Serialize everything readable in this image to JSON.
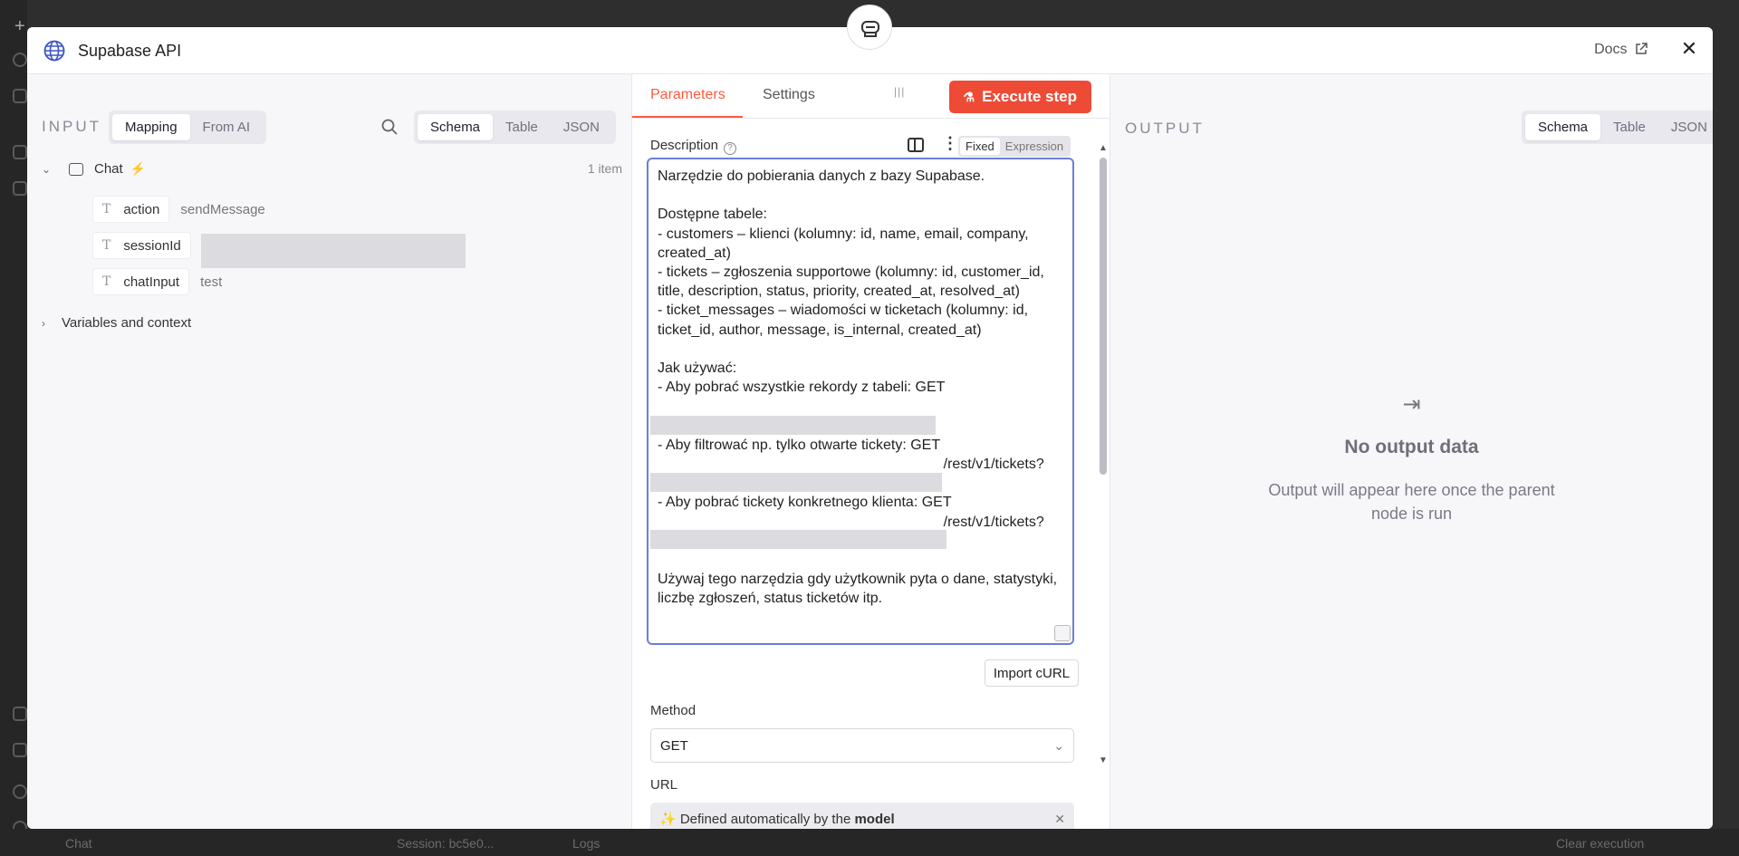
{
  "background": {
    "bottom_chat": "Chat",
    "bottom_session": "Session: bc5e0...",
    "bottom_logs": "Logs",
    "bottom_clear": "Clear execution"
  },
  "modal": {
    "title": "Supabase API",
    "docs_label": "Docs"
  },
  "input": {
    "label": "INPUT",
    "mode_tabs": [
      "Mapping",
      "From AI"
    ],
    "mode_selected": "Mapping",
    "view_tabs": [
      "Schema",
      "Table",
      "JSON"
    ],
    "view_selected": "Schema",
    "node_name": "Chat",
    "item_count": "1 item",
    "fields": [
      {
        "key": "action",
        "value": "sendMessage"
      },
      {
        "key": "sessionId",
        "value": ""
      },
      {
        "key": "chatInput",
        "value": "test"
      }
    ],
    "variables_label": "Variables and context"
  },
  "params": {
    "tabs": [
      "Parameters",
      "Settings"
    ],
    "active_tab": "Parameters",
    "execute_label": "Execute step",
    "description_label": "Description",
    "toggle": [
      "Fixed",
      "Expression"
    ],
    "toggle_selected": "Fixed",
    "description_text": "Narzędzie do pobierania danych z bazy Supabase.\n\nDostępne tabele:\n- customers – klienci (kolumny: id, name, email, company, created_at)\n- tickets – zgłoszenia supportowe (kolumny: id, customer_id, title, description, status, priority, created_at, resolved_at)\n- ticket_messages – wiadomości w ticketach (kolumny: id, ticket_id, author, message, is_internal, created_at)\n\nJak używać:\n- Aby pobrać wszystkie rekordy z tabeli: GET\n                                                                      /rest/v1/NAZWA_TABELI\n- Aby filtrować np. tylko otwarte tickety: GET\n                                                                       /rest/v1/tickets?status=eq.open\n- Aby pobrać tickety konkretnego klienta: GET\n                                                                       /rest/v1/tickets?customer_id=eq.UUID\n\nUżywaj tego narzędzia gdy użytkownik pyta o dane, statystyki, liczbę zgłoszeń, status ticketów itp.",
    "import_label": "Import cURL",
    "method_label": "Method",
    "method_value": "GET",
    "url_label": "URL",
    "url_auto_prefix": "✨ Defined automatically by the",
    "url_auto_bold": "model"
  },
  "output": {
    "label": "OUTPUT",
    "view_tabs": [
      "Schema",
      "Table",
      "JSON"
    ],
    "view_selected": "Schema",
    "empty_title": "No output data",
    "empty_sub": "Output will appear here once the parent node is run"
  },
  "colors": {
    "accent": "#ff5a3c",
    "execute_bg": "#ee4b37",
    "focus_border": "#6b7fd7"
  }
}
